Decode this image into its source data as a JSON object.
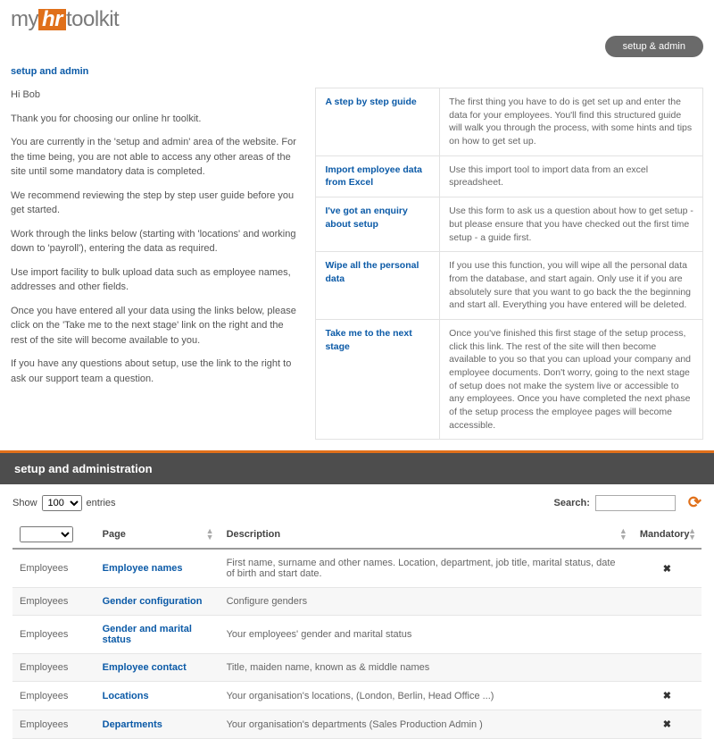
{
  "logo": {
    "part1": "my",
    "part2": "hr",
    "part3": "toolkit"
  },
  "topbar": {
    "setup_btn": "setup & admin"
  },
  "breadcrumb": "setup and admin",
  "intro": {
    "p1": "Hi Bob",
    "p2": "Thank you for choosing our online hr toolkit.",
    "p3": "You are currently in the 'setup and admin' area of the website. For the time being, you are not able to access any other areas of the site until some mandatory data is completed.",
    "p4": "We recommend reviewing the step by step user guide before you get started.",
    "p5": "Work through the links below (starting with 'locations' and working down to 'payroll'), entering the data as required.",
    "p6": "Use import facility to bulk upload data such as employee names, addresses and other fields.",
    "p7": "Once you have entered all your data using the links below, please click on the 'Take me to the next stage' link on the right and the rest of the site will become available to you.",
    "p8": "If you have any questions about setup, use the link to the right to ask our support team a question."
  },
  "guide": [
    {
      "title": "A step by step guide",
      "desc": "The first thing you have to do is get set up and enter the data for your employees. You'll find this structured guide will walk you through the process, with some hints and tips on how to get set up."
    },
    {
      "title": "Import employee data from Excel",
      "desc": "Use this import tool to import data from an excel spreadsheet."
    },
    {
      "title": "I've got an enquiry about setup",
      "desc": "Use this form to ask us a question about how to get setup - but please ensure that you have checked out the first time setup - a guide first."
    },
    {
      "title": "Wipe all the personal data",
      "desc": "If you use this function, you will wipe all the personal data from the database, and start again. Only use it if you are absolutely sure that you want to go back the the beginning and start all. Everything you have entered will be deleted."
    },
    {
      "title": "Take me to the next stage",
      "desc": "Once you've finished this first stage of the setup process, click this link. The rest of the site will then become available to you so that you can upload your company and employee documents. Don't worry, going to the next stage of setup does not make the system live or accessible to any employees. Once you have completed the next phase of the setup process the employee pages will become accessible."
    }
  ],
  "section_title": "setup and administration",
  "controls": {
    "show": "Show",
    "entries": "entries",
    "page_size": "100",
    "search_label": "Search:"
  },
  "columns": {
    "page": "Page",
    "description": "Description",
    "mandatory": "Mandatory"
  },
  "rows": [
    {
      "cat": "Employees",
      "page": "Employee names",
      "desc": "First name, surname and other names. Location, department, job title, marital status, date of birth and start date.",
      "mand": "✖"
    },
    {
      "cat": "Employees",
      "page": "Gender configuration",
      "desc": "Configure genders",
      "mand": ""
    },
    {
      "cat": "Employees",
      "page": "Gender and marital status",
      "desc": "Your employees' gender and marital status",
      "mand": ""
    },
    {
      "cat": "Employees",
      "page": "Employee contact",
      "desc": "Title, maiden name, known as & middle names",
      "mand": ""
    },
    {
      "cat": "Employees",
      "page": "Locations",
      "desc": "Your organisation's locations, (London, Berlin, Head Office ...)",
      "mand": "✖"
    },
    {
      "cat": "Employees",
      "page": "Departments",
      "desc": "Your organisation's departments  (Sales  Production  Admin   )",
      "mand": "✖"
    }
  ]
}
